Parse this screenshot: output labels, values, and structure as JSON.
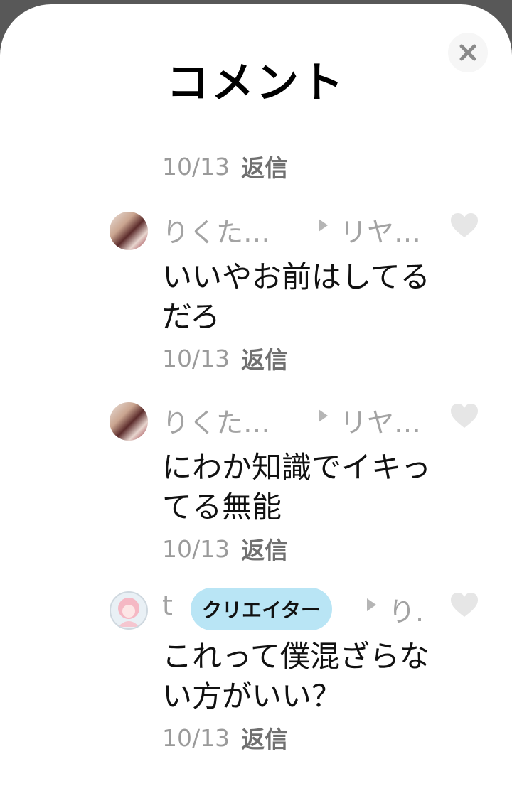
{
  "header": {
    "title": "コメント"
  },
  "thread": {
    "top_meta": {
      "date": "10/13",
      "reply": "返信"
    },
    "comments": [
      {
        "author": "りくた…",
        "reply_to": "リヤ…",
        "text": "いいやお前はしてるだろ",
        "date": "10/13",
        "reply": "返信"
      },
      {
        "author": "りくた…",
        "reply_to": "リヤ…",
        "text": "にわか知識でイキってる無能",
        "date": "10/13",
        "reply": "返信"
      },
      {
        "author": "t",
        "badge": "クリエイター",
        "reply_to": "り.",
        "text": "これって僕混ざらない方がいい？",
        "date": "10/13",
        "reply": "返信"
      }
    ]
  },
  "icons": {
    "close": "close-icon",
    "heart": "heart-icon",
    "arrow": "reply-arrow-icon"
  },
  "colors": {
    "badge_bg": "#b9e5f5",
    "muted": "#9a9a9a",
    "heart": "#e6e6e6"
  }
}
